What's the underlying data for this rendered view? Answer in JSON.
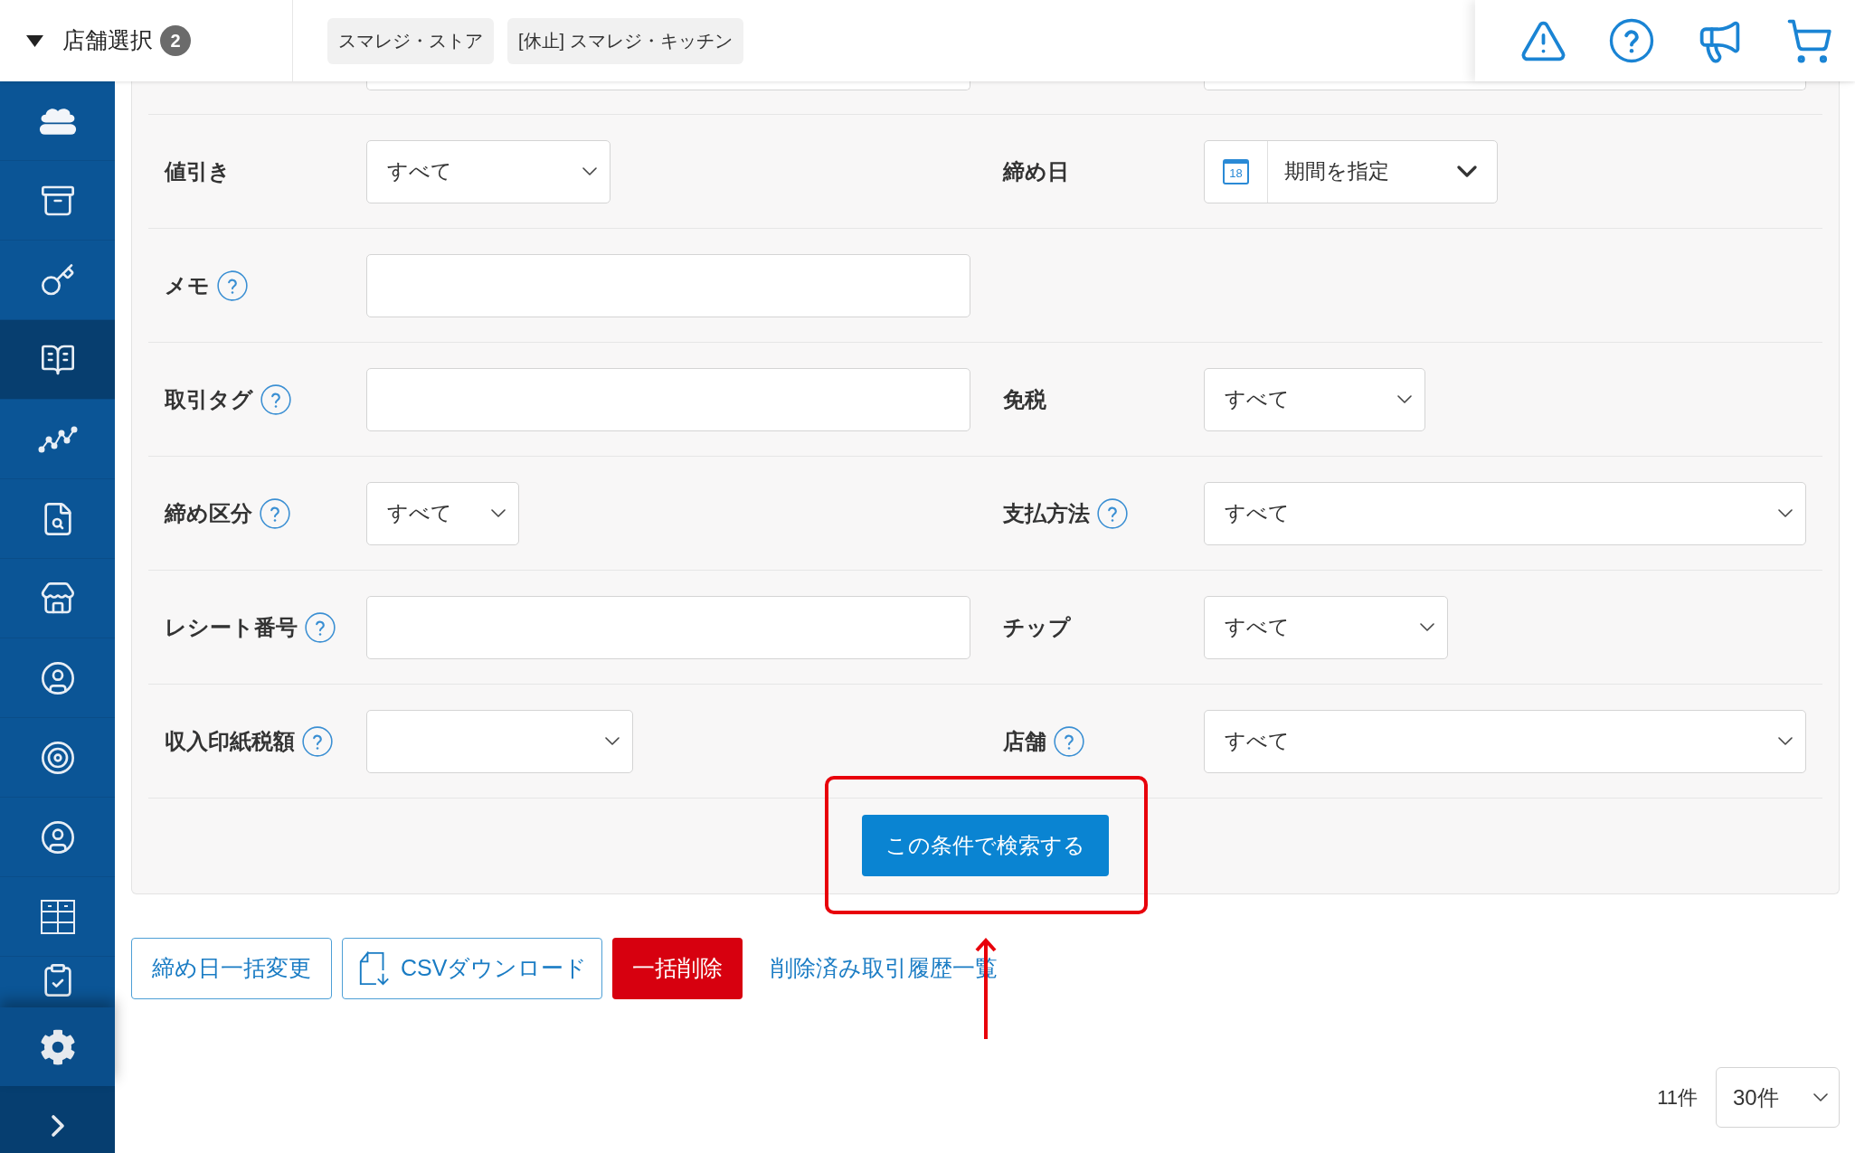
{
  "header": {
    "store_selector": {
      "label": "店舗選択",
      "count": "2"
    },
    "stores": [
      {
        "name": "スマレジ・ストア"
      },
      {
        "name": "[休止] スマレジ・キッチン"
      }
    ]
  },
  "sidebar": {
    "items": [
      {
        "selected": false
      },
      {
        "selected": false
      },
      {
        "selected": false
      },
      {
        "selected": true
      },
      {
        "selected": false
      },
      {
        "selected": false
      },
      {
        "selected": false
      },
      {
        "selected": false
      },
      {
        "selected": false
      },
      {
        "selected": false
      },
      {
        "selected": false
      },
      {
        "selected": false
      }
    ]
  },
  "form": {
    "rows": [
      {
        "left": {
          "label": "値引き",
          "help": false,
          "kind": "select",
          "value": "すべて"
        },
        "right": {
          "label": "締め日",
          "help": false,
          "kind": "date_range",
          "value": "期間を指定",
          "calendar_day": "18"
        }
      },
      {
        "left": {
          "label": "メモ",
          "help": true,
          "kind": "text"
        }
      },
      {
        "left": {
          "label": "取引タグ",
          "help": true,
          "kind": "text"
        },
        "right": {
          "label": "免税",
          "help": false,
          "kind": "select",
          "value": "すべて"
        }
      },
      {
        "left": {
          "label": "締め区分",
          "help": true,
          "kind": "select",
          "value": "すべて"
        },
        "right": {
          "label": "支払方法",
          "help": true,
          "kind": "select",
          "value": "すべて"
        }
      },
      {
        "left": {
          "label": "レシート番号",
          "help": true,
          "kind": "text"
        },
        "right": {
          "label": "チップ",
          "help": false,
          "kind": "select",
          "value": "すべて"
        }
      },
      {
        "left": {
          "label": "収入印紙税額",
          "help": true,
          "kind": "select"
        },
        "right": {
          "label": "店舗",
          "help": true,
          "kind": "select",
          "value": "すべて"
        }
      }
    ],
    "search_button": "この条件で検索する"
  },
  "actions": [
    {
      "kind": "outline",
      "label": "締め日一括変更"
    },
    {
      "kind": "download",
      "label": "CSVダウンロード"
    },
    {
      "kind": "danger",
      "label": "一括削除"
    },
    {
      "kind": "link",
      "label": "削除済み取引履歴一覧"
    }
  ],
  "pagination": {
    "total": "11件",
    "page_size": "30件"
  }
}
